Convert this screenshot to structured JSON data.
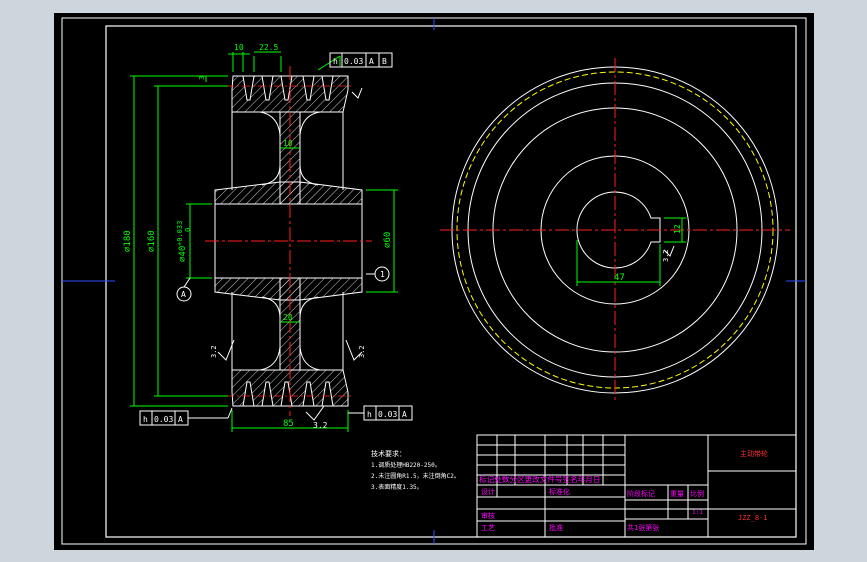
{
  "colors": {
    "background": "#000000",
    "frame": "#ffffff",
    "dimension": "#00ff00",
    "center_line": "#ff2020",
    "title_text": "#ff00ff",
    "title_red": "#ff3030",
    "hatch": "#ffffff",
    "dashed_circle": "#ffff00"
  },
  "dims": {
    "top_10": "10",
    "top_22_5": "22.5",
    "rib_10": "10",
    "rib_20": "20",
    "od_180": "⌀180",
    "pd_160": "⌀160",
    "bore_40": "⌀40",
    "bore_tol": "+0.033",
    "bore_tol_low": "0",
    "hub_60": "⌀60",
    "width_85": "85",
    "key_47": "47",
    "key_12": "12",
    "ra_left": "3.2",
    "ra_right": "3.2",
    "ra_bottom": "3.2",
    "ra_key": "3.2",
    "ra_top": "3"
  },
  "datums": {
    "a": "A",
    "one": "1"
  },
  "gdt": {
    "top": [
      "h",
      "0.03",
      "A",
      "B"
    ],
    "left": [
      "h",
      "0.03",
      "A"
    ],
    "right": [
      "h",
      "0.03",
      "A"
    ]
  },
  "tech": {
    "heading": "技术要求：",
    "line1": "1.调质处理HB220-250。",
    "line2": "2.未注圆角R1.5，未注倒角C2。",
    "line3": "3.表面精度1.35。"
  },
  "title_block": {
    "row_labels": "标记处数分区更改文件号签名年月日",
    "design": "设计",
    "standard": "标准化",
    "stage": "阶段标记",
    "weight": "重量",
    "scale": "比例",
    "review": "审核",
    "craft": "工艺",
    "approve": "批准",
    "sheets": "共1张第张",
    "scale_value": "1:1",
    "part_name": "主动带轮",
    "drawing_no": "JZZ_8-1"
  }
}
